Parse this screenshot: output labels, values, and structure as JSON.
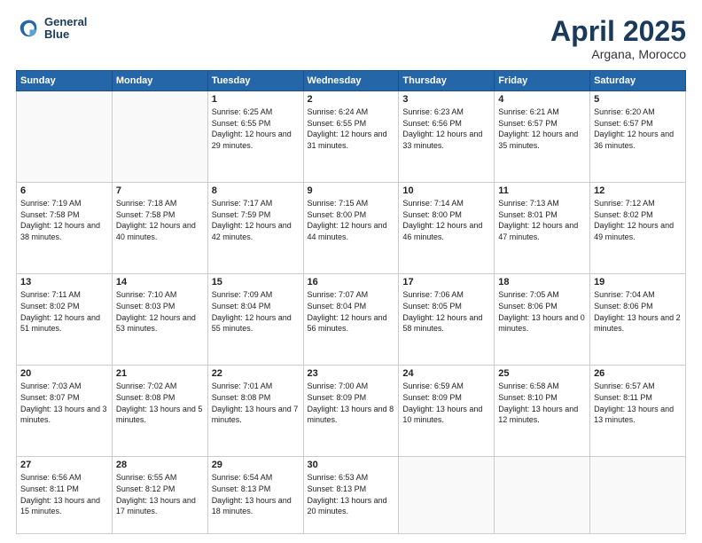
{
  "header": {
    "logo_line1": "General",
    "logo_line2": "Blue",
    "month_title": "April 2025",
    "location": "Argana, Morocco"
  },
  "days_of_week": [
    "Sunday",
    "Monday",
    "Tuesday",
    "Wednesday",
    "Thursday",
    "Friday",
    "Saturday"
  ],
  "weeks": [
    [
      {
        "day": "",
        "sunrise": "",
        "sunset": "",
        "daylight": ""
      },
      {
        "day": "",
        "sunrise": "",
        "sunset": "",
        "daylight": ""
      },
      {
        "day": "1",
        "sunrise": "Sunrise: 6:25 AM",
        "sunset": "Sunset: 6:55 PM",
        "daylight": "Daylight: 12 hours and 29 minutes."
      },
      {
        "day": "2",
        "sunrise": "Sunrise: 6:24 AM",
        "sunset": "Sunset: 6:55 PM",
        "daylight": "Daylight: 12 hours and 31 minutes."
      },
      {
        "day": "3",
        "sunrise": "Sunrise: 6:23 AM",
        "sunset": "Sunset: 6:56 PM",
        "daylight": "Daylight: 12 hours and 33 minutes."
      },
      {
        "day": "4",
        "sunrise": "Sunrise: 6:21 AM",
        "sunset": "Sunset: 6:57 PM",
        "daylight": "Daylight: 12 hours and 35 minutes."
      },
      {
        "day": "5",
        "sunrise": "Sunrise: 6:20 AM",
        "sunset": "Sunset: 6:57 PM",
        "daylight": "Daylight: 12 hours and 36 minutes."
      }
    ],
    [
      {
        "day": "6",
        "sunrise": "Sunrise: 7:19 AM",
        "sunset": "Sunset: 7:58 PM",
        "daylight": "Daylight: 12 hours and 38 minutes."
      },
      {
        "day": "7",
        "sunrise": "Sunrise: 7:18 AM",
        "sunset": "Sunset: 7:58 PM",
        "daylight": "Daylight: 12 hours and 40 minutes."
      },
      {
        "day": "8",
        "sunrise": "Sunrise: 7:17 AM",
        "sunset": "Sunset: 7:59 PM",
        "daylight": "Daylight: 12 hours and 42 minutes."
      },
      {
        "day": "9",
        "sunrise": "Sunrise: 7:15 AM",
        "sunset": "Sunset: 8:00 PM",
        "daylight": "Daylight: 12 hours and 44 minutes."
      },
      {
        "day": "10",
        "sunrise": "Sunrise: 7:14 AM",
        "sunset": "Sunset: 8:00 PM",
        "daylight": "Daylight: 12 hours and 46 minutes."
      },
      {
        "day": "11",
        "sunrise": "Sunrise: 7:13 AM",
        "sunset": "Sunset: 8:01 PM",
        "daylight": "Daylight: 12 hours and 47 minutes."
      },
      {
        "day": "12",
        "sunrise": "Sunrise: 7:12 AM",
        "sunset": "Sunset: 8:02 PM",
        "daylight": "Daylight: 12 hours and 49 minutes."
      }
    ],
    [
      {
        "day": "13",
        "sunrise": "Sunrise: 7:11 AM",
        "sunset": "Sunset: 8:02 PM",
        "daylight": "Daylight: 12 hours and 51 minutes."
      },
      {
        "day": "14",
        "sunrise": "Sunrise: 7:10 AM",
        "sunset": "Sunset: 8:03 PM",
        "daylight": "Daylight: 12 hours and 53 minutes."
      },
      {
        "day": "15",
        "sunrise": "Sunrise: 7:09 AM",
        "sunset": "Sunset: 8:04 PM",
        "daylight": "Daylight: 12 hours and 55 minutes."
      },
      {
        "day": "16",
        "sunrise": "Sunrise: 7:07 AM",
        "sunset": "Sunset: 8:04 PM",
        "daylight": "Daylight: 12 hours and 56 minutes."
      },
      {
        "day": "17",
        "sunrise": "Sunrise: 7:06 AM",
        "sunset": "Sunset: 8:05 PM",
        "daylight": "Daylight: 12 hours and 58 minutes."
      },
      {
        "day": "18",
        "sunrise": "Sunrise: 7:05 AM",
        "sunset": "Sunset: 8:06 PM",
        "daylight": "Daylight: 13 hours and 0 minutes."
      },
      {
        "day": "19",
        "sunrise": "Sunrise: 7:04 AM",
        "sunset": "Sunset: 8:06 PM",
        "daylight": "Daylight: 13 hours and 2 minutes."
      }
    ],
    [
      {
        "day": "20",
        "sunrise": "Sunrise: 7:03 AM",
        "sunset": "Sunset: 8:07 PM",
        "daylight": "Daylight: 13 hours and 3 minutes."
      },
      {
        "day": "21",
        "sunrise": "Sunrise: 7:02 AM",
        "sunset": "Sunset: 8:08 PM",
        "daylight": "Daylight: 13 hours and 5 minutes."
      },
      {
        "day": "22",
        "sunrise": "Sunrise: 7:01 AM",
        "sunset": "Sunset: 8:08 PM",
        "daylight": "Daylight: 13 hours and 7 minutes."
      },
      {
        "day": "23",
        "sunrise": "Sunrise: 7:00 AM",
        "sunset": "Sunset: 8:09 PM",
        "daylight": "Daylight: 13 hours and 8 minutes."
      },
      {
        "day": "24",
        "sunrise": "Sunrise: 6:59 AM",
        "sunset": "Sunset: 8:09 PM",
        "daylight": "Daylight: 13 hours and 10 minutes."
      },
      {
        "day": "25",
        "sunrise": "Sunrise: 6:58 AM",
        "sunset": "Sunset: 8:10 PM",
        "daylight": "Daylight: 13 hours and 12 minutes."
      },
      {
        "day": "26",
        "sunrise": "Sunrise: 6:57 AM",
        "sunset": "Sunset: 8:11 PM",
        "daylight": "Daylight: 13 hours and 13 minutes."
      }
    ],
    [
      {
        "day": "27",
        "sunrise": "Sunrise: 6:56 AM",
        "sunset": "Sunset: 8:11 PM",
        "daylight": "Daylight: 13 hours and 15 minutes."
      },
      {
        "day": "28",
        "sunrise": "Sunrise: 6:55 AM",
        "sunset": "Sunset: 8:12 PM",
        "daylight": "Daylight: 13 hours and 17 minutes."
      },
      {
        "day": "29",
        "sunrise": "Sunrise: 6:54 AM",
        "sunset": "Sunset: 8:13 PM",
        "daylight": "Daylight: 13 hours and 18 minutes."
      },
      {
        "day": "30",
        "sunrise": "Sunrise: 6:53 AM",
        "sunset": "Sunset: 8:13 PM",
        "daylight": "Daylight: 13 hours and 20 minutes."
      },
      {
        "day": "",
        "sunrise": "",
        "sunset": "",
        "daylight": ""
      },
      {
        "day": "",
        "sunrise": "",
        "sunset": "",
        "daylight": ""
      },
      {
        "day": "",
        "sunrise": "",
        "sunset": "",
        "daylight": ""
      }
    ]
  ]
}
